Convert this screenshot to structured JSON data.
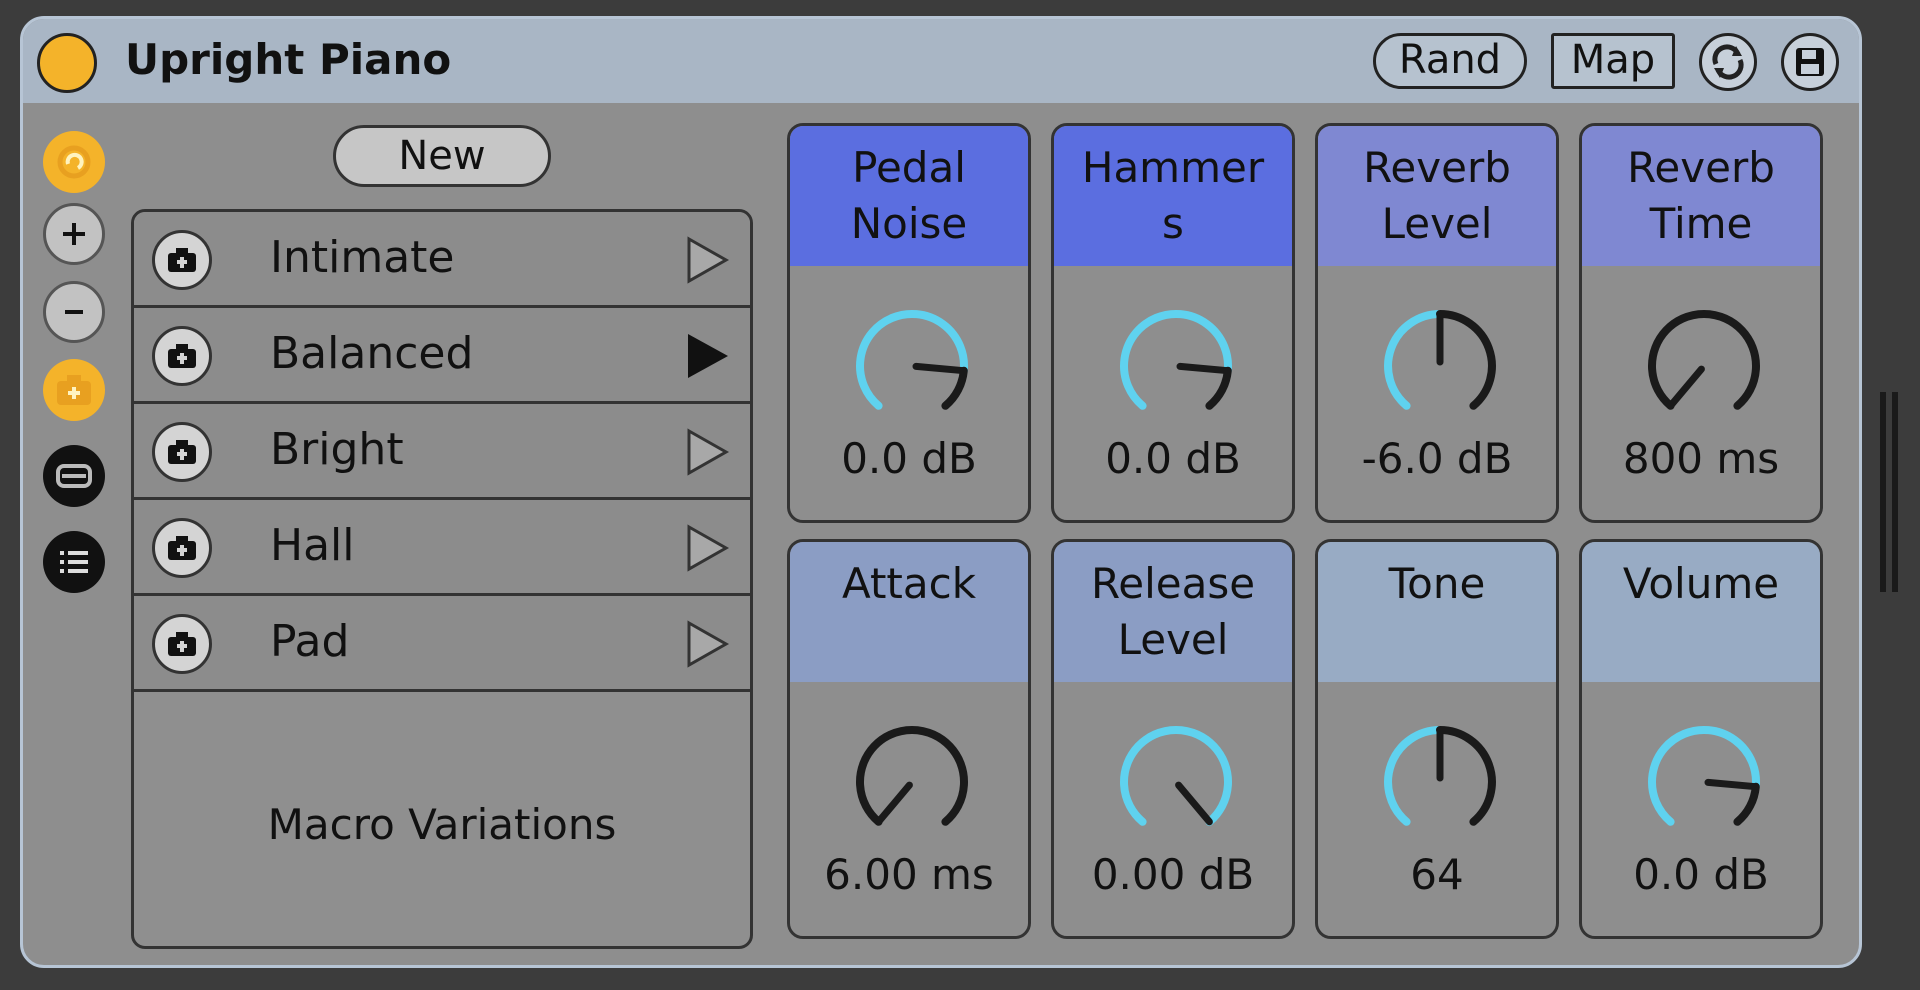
{
  "device": {
    "title": "Upright Piano",
    "rand_label": "Rand",
    "map_label": "Map",
    "power_color": "#f4b32a",
    "titlebar_color": "#a9b6c5"
  },
  "side_icons": [
    "hot-swap-icon",
    "plus-icon",
    "minus-icon",
    "camera-icon",
    "macro-variations-icon",
    "list-icon"
  ],
  "variations": {
    "new_label": "New",
    "items": [
      {
        "label": "Intimate",
        "active": false
      },
      {
        "label": "Balanced",
        "active": true
      },
      {
        "label": "Bright",
        "active": false
      },
      {
        "label": "Hall",
        "active": false
      },
      {
        "label": "Pad",
        "active": false
      }
    ],
    "footer_label": "Macro Variations"
  },
  "macros": [
    {
      "name": "Pedal\nNoise",
      "value": "0.0 dB",
      "level": 0.84,
      "header_color": "#5b6ee0"
    },
    {
      "name": "Hammer\ns",
      "value": "0.0 dB",
      "level": 0.84,
      "header_color": "#5b6ee0"
    },
    {
      "name": "Reverb\nLevel",
      "value": "-6.0 dB",
      "level": 0.5,
      "header_color": "#7f88d2"
    },
    {
      "name": "Reverb\nTime",
      "value": "800 ms",
      "level": 0.0,
      "header_color": "#7f88d2"
    },
    {
      "name": "Attack",
      "value": "6.00 ms",
      "level": 0.0,
      "header_color": "#8b9dc4"
    },
    {
      "name": "Release\nLevel",
      "value": "0.00 dB",
      "level": 1.0,
      "header_color": "#8b9dc4"
    },
    {
      "name": "Tone",
      "value": "64",
      "level": 0.5,
      "header_color": "#98abc4"
    },
    {
      "name": "Volume",
      "value": "0.0 dB",
      "level": 0.84,
      "header_color": "#98abc4"
    }
  ]
}
